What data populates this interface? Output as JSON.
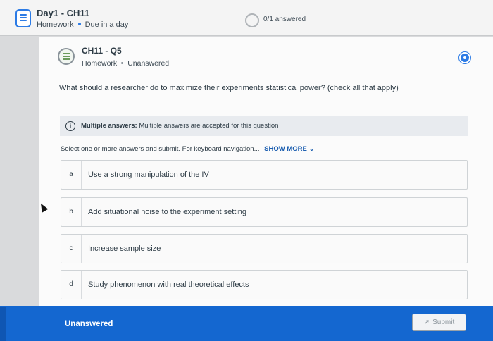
{
  "assignment": {
    "title": "Day1 - CH11",
    "type": "Homework",
    "due": "Due in a day",
    "progress": "0/1 answered"
  },
  "question": {
    "title": "CH11 - Q5",
    "type": "Homework",
    "status": "Unanswered",
    "prompt": "What should a researcher do to maximize their experiments statistical power? (check all that apply)"
  },
  "banner": {
    "label": "Multiple answers:",
    "text": "Multiple answers are accepted for this question"
  },
  "instructions": {
    "text": "Select one or more answers and submit. For keyboard navigation...",
    "show_more": "SHOW MORE"
  },
  "options": [
    {
      "letter": "a",
      "text": "Use a strong manipulation of the IV"
    },
    {
      "letter": "b",
      "text": "Add situational noise to the experiment setting"
    },
    {
      "letter": "c",
      "text": "Increase sample size"
    },
    {
      "letter": "d",
      "text": "Study phenomenon with real theoretical effects"
    }
  ],
  "footer": {
    "status": "Unanswered",
    "submit_label": "Submit"
  },
  "colors": {
    "accent": "#1467d0",
    "text": "#2d3b45"
  }
}
